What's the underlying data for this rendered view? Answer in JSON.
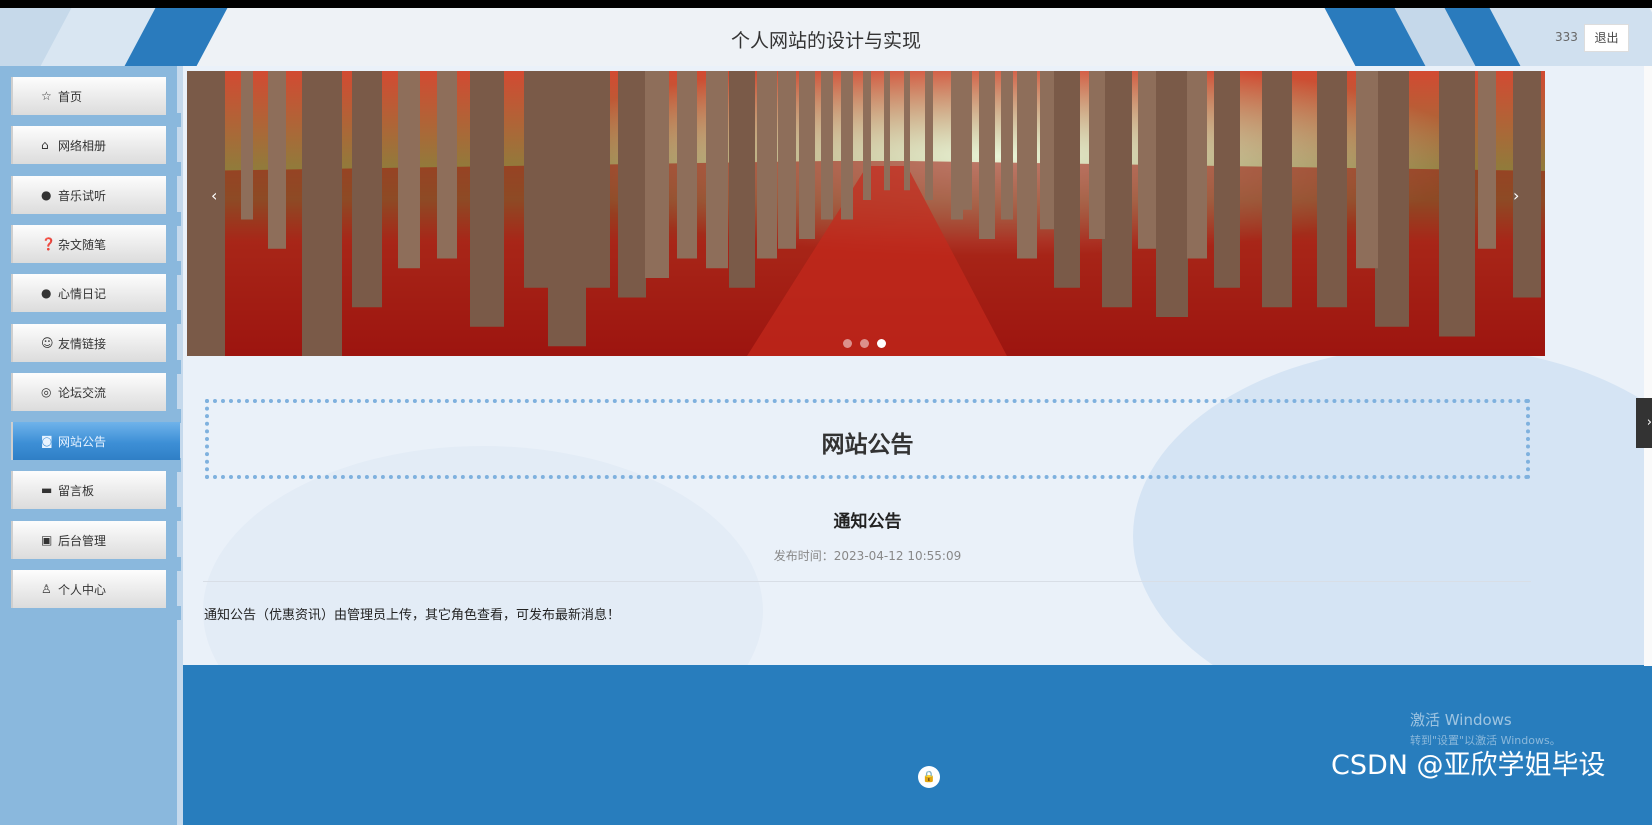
{
  "header": {
    "site_title": "个人网站的设计与实现",
    "username": "333",
    "logout_label": "退出"
  },
  "sidebar": {
    "items": [
      {
        "label": "首页",
        "icon": "star-icon",
        "glyph": "☆",
        "active": false
      },
      {
        "label": "网络相册",
        "icon": "bag-icon",
        "glyph": "⌂",
        "active": false
      },
      {
        "label": "音乐试听",
        "icon": "info-circle-icon",
        "glyph": "●",
        "active": false
      },
      {
        "label": "杂文随笔",
        "icon": "question-circle-icon",
        "glyph": "❓",
        "active": false
      },
      {
        "label": "心情日记",
        "icon": "info-circle-icon",
        "glyph": "●",
        "active": false
      },
      {
        "label": "友情链接",
        "icon": "smile-icon",
        "glyph": "☺",
        "active": false
      },
      {
        "label": "论坛交流",
        "icon": "check-circle-icon",
        "glyph": "◎",
        "active": false
      },
      {
        "label": "网站公告",
        "icon": "camera-icon",
        "glyph": "◙",
        "active": true
      },
      {
        "label": "留言板",
        "icon": "printer-icon",
        "glyph": "▬",
        "active": false
      },
      {
        "label": "后台管理",
        "icon": "briefcase-icon",
        "glyph": "▣",
        "active": false
      },
      {
        "label": "个人中心",
        "icon": "user-icon",
        "glyph": "♙",
        "active": false
      }
    ]
  },
  "banner": {
    "prev": "‹",
    "next": "›",
    "slide_count": 3,
    "active_slide": 3
  },
  "notice": {
    "heading": "网站公告",
    "article_title": "通知公告",
    "publish_label": "发布时间：",
    "publish_time": "2023-04-12 10:55:09",
    "body": "通知公告（优惠资讯）由管理员上传，其它角色查看，可发布最新消息！"
  },
  "footer": {
    "lock_icon": "lock-icon"
  },
  "overlays": {
    "windows_line1": "激活 Windows",
    "windows_line2": "转到\"设置\"以激活 Windows。",
    "watermark": "CSDN @亚欣学姐毕设"
  },
  "colors": {
    "brand_blue": "#287dbd",
    "sidebar_blue": "#8ab8dd",
    "active_nav": "#3d8fd6",
    "dotted_border": "#7fb1de",
    "banner_red": "#b81b16"
  }
}
